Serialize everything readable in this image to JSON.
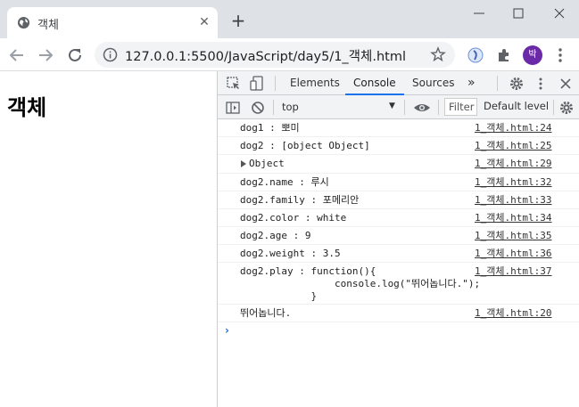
{
  "browser": {
    "tab_title": "객체",
    "url": "127.0.0.1:5500/JavaScript/day5/1_객체.html",
    "avatar_label": "박",
    "new_tab": "+",
    "tab_close": "✕"
  },
  "page": {
    "heading": "객체"
  },
  "devtools": {
    "tabs": [
      "Elements",
      "Console",
      "Sources"
    ],
    "more_tabs": "»",
    "active_tab": "Console",
    "context": "top",
    "filter_placeholder": "Filter",
    "levels": "Default level",
    "logs": [
      {
        "msg": "dog1 : 뽀미",
        "src": "1_객체.html:24"
      },
      {
        "msg": "dog2 : [object Object]",
        "src": "1_객체.html:25"
      },
      {
        "msg": "Object",
        "src": "1_객체.html:29",
        "expandable": true
      },
      {
        "msg": "dog2.name : 루시",
        "src": "1_객체.html:32"
      },
      {
        "msg": "dog2.family : 포메리안",
        "src": "1_객체.html:33"
      },
      {
        "msg": "dog2.color : white",
        "src": "1_객체.html:34"
      },
      {
        "msg": "dog2.age : 9",
        "src": "1_객체.html:35"
      },
      {
        "msg": "dog2.weight : 3.5",
        "src": "1_객체.html:36"
      },
      {
        "msg": "dog2.play : function(){\n                console.log(\"뛰어놉니다.\");\n            }",
        "src": "1_객체.html:37"
      },
      {
        "msg": "뛰어놉니다.",
        "src": "1_객체.html:20"
      }
    ],
    "prompt": "›"
  },
  "colors": {
    "accent": "#1a73e8",
    "avatar": "#6a2aa8",
    "tabstrip": "#dee1e6"
  }
}
